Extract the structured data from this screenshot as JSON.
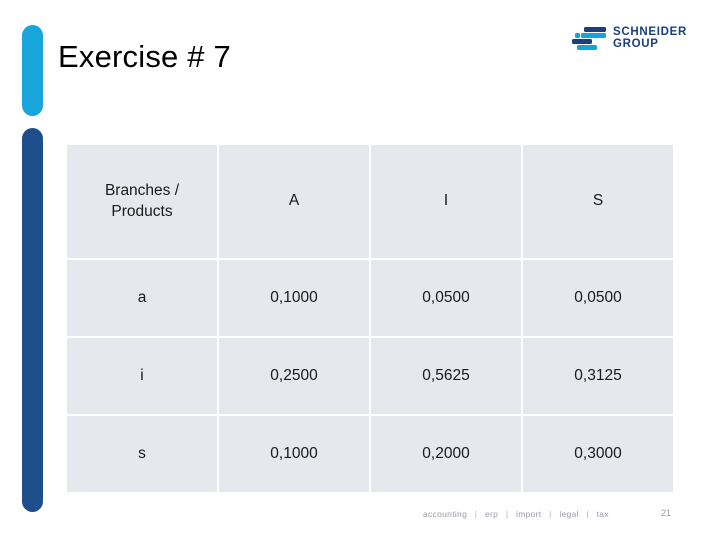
{
  "slide": {
    "title": "Exercise # 7",
    "page_number": "21"
  },
  "branding": {
    "logo_name": "schneider-group-logo",
    "line1": "SCHNEIDER",
    "line2": "GROUP",
    "navy": "#1b3f7a",
    "cyan": "#15a3db"
  },
  "accents": {
    "cyan_bar": "#18a5dc",
    "navy_bar": "#1f4e8c"
  },
  "table": {
    "cell_background": "#e7e7ee",
    "headers": [
      "Branches / Products",
      "A",
      "I",
      "S"
    ],
    "header_label_line1": "Branches /",
    "header_label_line2": "Products",
    "rows": [
      {
        "label": "a",
        "values": [
          "0,1000",
          "0,0500",
          "0,0500"
        ]
      },
      {
        "label": "i",
        "values": [
          "0,2500",
          "0,5625",
          "0,3125"
        ]
      },
      {
        "label": "s",
        "values": [
          "0,1000",
          "0,2000",
          "0,3000"
        ]
      }
    ]
  },
  "footer": {
    "items": [
      "accounting",
      "erp",
      "import",
      "legal",
      "tax"
    ],
    "separator": "|"
  }
}
